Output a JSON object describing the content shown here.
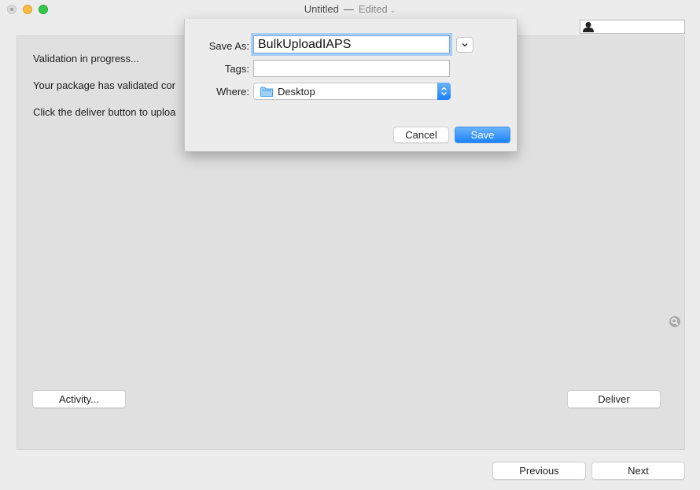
{
  "window": {
    "title": "Untitled",
    "separator": "—",
    "status": "Edited"
  },
  "messages": [
    "Validation in progress...",
    "Your package has validated cor",
    "Click the deliver button to uploa"
  ],
  "buttons": {
    "activity": "Activity...",
    "deliver": "Deliver",
    "previous": "Previous",
    "next": "Next"
  },
  "save_sheet": {
    "save_as_label": "Save As:",
    "save_as_value": "BulkUploadIAPS",
    "tags_label": "Tags:",
    "tags_value": "",
    "where_label": "Where:",
    "where_value": "Desktop",
    "cancel_label": "Cancel",
    "save_label": "Save"
  },
  "icons": {
    "user": "user-icon",
    "zoom": "magnifier-icon",
    "folder": "folder-icon",
    "expand": "chevron-down-icon",
    "stepper": "up-down-arrows-icon"
  },
  "colors": {
    "accent": "#1a82fb",
    "focus_ring": "#a9cdf5",
    "close_inactive": "#dcdcdc",
    "minimize": "#fdbc40",
    "maximize": "#34c84a"
  }
}
